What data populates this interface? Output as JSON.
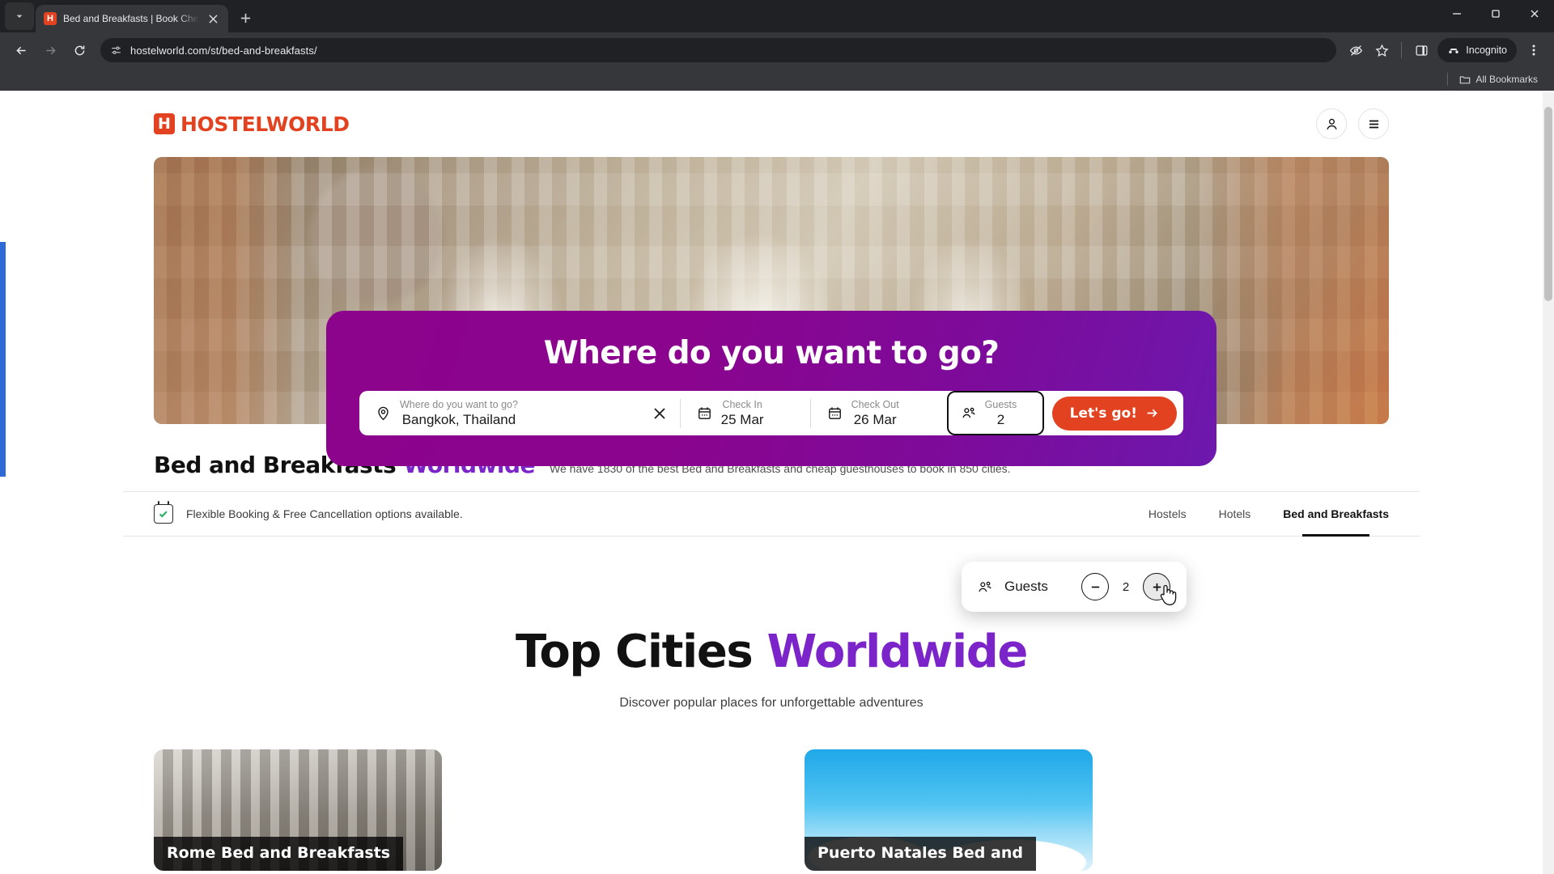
{
  "browser": {
    "tab": {
      "title": "Bed and Breakfasts | Book Chea",
      "favicon_letter": "H"
    },
    "new_tab_label": "+",
    "url": "hostelworld.com/st/bed-and-breakfasts/",
    "incognito_label": "Incognito",
    "bookmarks_label": "All Bookmarks"
  },
  "header": {
    "logo_mark": "H",
    "logo_text": "HOSTELWORLD"
  },
  "search_panel": {
    "heading": "Where do you want to go?",
    "destination": {
      "label": "Where do you want to go?",
      "value": "Bangkok, Thailand"
    },
    "check_in": {
      "label": "Check In",
      "value": "25 Mar"
    },
    "check_out": {
      "label": "Check Out",
      "value": "26 Mar"
    },
    "guests": {
      "label": "Guests",
      "value": "2"
    },
    "submit_label": "Let's go!"
  },
  "guests_dropdown": {
    "label": "Guests",
    "count": "2",
    "decrement": "−",
    "increment": "+"
  },
  "bed_breakfasts": {
    "title": "Bed and Breakfasts",
    "title_accent": "Worldwide",
    "subtitle": "We have 1830 of the best Bed and Breakfasts and cheap guesthouses to book in 850 cities."
  },
  "filter_bar": {
    "flexible_text": "Flexible Booking & Free Cancellation options available.",
    "tabs": [
      {
        "label": "Hostels",
        "active": false
      },
      {
        "label": "Hotels",
        "active": false
      },
      {
        "label": "Bed and Breakfasts",
        "active": true
      }
    ]
  },
  "top_cities": {
    "title": "Top Cities",
    "title_accent": "Worldwide",
    "subtitle": "Discover popular places for unforgettable adventures",
    "cards": [
      {
        "label": "Rome Bed and Breakfasts"
      },
      {
        "label": "Puerto Natales Bed and"
      }
    ]
  },
  "colors": {
    "brand_orange": "#e2421f",
    "accent_purple": "#7b24c9",
    "panel_purple": "#8c038c",
    "chrome_dark": "#202124",
    "success_green": "#27ae60"
  }
}
